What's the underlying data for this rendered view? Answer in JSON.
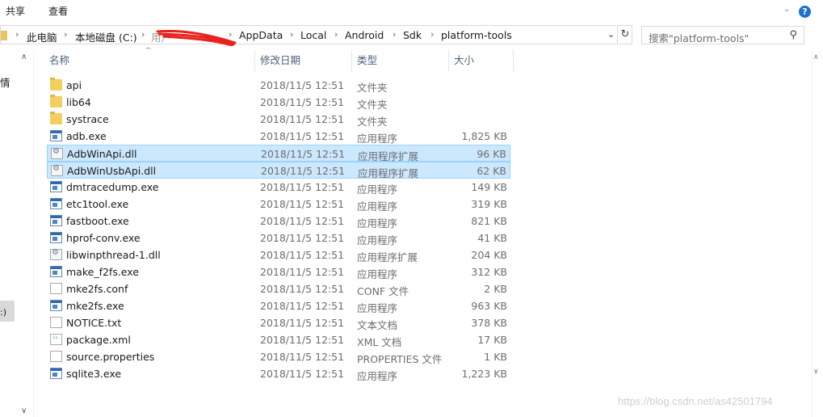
{
  "ribbon": {
    "tabs": [
      "共享",
      "查看"
    ],
    "expand": "⌄",
    "help": "?"
  },
  "address": {
    "crumbs": [
      "此电脑",
      "本地磁盘 (C:)",
      "用户",
      "AppData",
      "Local",
      "Android",
      "Sdk",
      "platform-tools"
    ],
    "dropdown": "⌄",
    "refresh": "↻"
  },
  "search": {
    "placeholder": "搜索\"platform-tools\""
  },
  "nav": {
    "text1": "情",
    "text2": ":)"
  },
  "columns": {
    "name": "名称",
    "date": "修改日期",
    "type": "类型",
    "size": "大小"
  },
  "files": [
    {
      "name": "api",
      "date": "2018/11/5 12:51",
      "type": "文件夹",
      "size": "",
      "icon": "folder-icon",
      "selected": false
    },
    {
      "name": "lib64",
      "date": "2018/11/5 12:51",
      "type": "文件夹",
      "size": "",
      "icon": "folder-icon",
      "selected": false
    },
    {
      "name": "systrace",
      "date": "2018/11/5 12:51",
      "type": "文件夹",
      "size": "",
      "icon": "folder-icon",
      "selected": false
    },
    {
      "name": "adb.exe",
      "date": "2018/11/5 12:51",
      "type": "应用程序",
      "size": "1,825 KB",
      "icon": "exe-icon",
      "selected": false
    },
    {
      "name": "AdbWinApi.dll",
      "date": "2018/11/5 12:51",
      "type": "应用程序扩展",
      "size": "96 KB",
      "icon": "dll-icon",
      "selected": true
    },
    {
      "name": "AdbWinUsbApi.dll",
      "date": "2018/11/5 12:51",
      "type": "应用程序扩展",
      "size": "62 KB",
      "icon": "dll-icon",
      "selected": true
    },
    {
      "name": "dmtracedump.exe",
      "date": "2018/11/5 12:51",
      "type": "应用程序",
      "size": "149 KB",
      "icon": "exe-icon",
      "selected": false
    },
    {
      "name": "etc1tool.exe",
      "date": "2018/11/5 12:51",
      "type": "应用程序",
      "size": "319 KB",
      "icon": "exe-icon",
      "selected": false
    },
    {
      "name": "fastboot.exe",
      "date": "2018/11/5 12:51",
      "type": "应用程序",
      "size": "821 KB",
      "icon": "exe-icon",
      "selected": false
    },
    {
      "name": "hprof-conv.exe",
      "date": "2018/11/5 12:51",
      "type": "应用程序",
      "size": "41 KB",
      "icon": "exe-icon",
      "selected": false
    },
    {
      "name": "libwinpthread-1.dll",
      "date": "2018/11/5 12:51",
      "type": "应用程序扩展",
      "size": "204 KB",
      "icon": "dll-icon",
      "selected": false
    },
    {
      "name": "make_f2fs.exe",
      "date": "2018/11/5 12:51",
      "type": "应用程序",
      "size": "312 KB",
      "icon": "exe-icon",
      "selected": false
    },
    {
      "name": "mke2fs.conf",
      "date": "2018/11/5 12:51",
      "type": "CONF 文件",
      "size": "2 KB",
      "icon": "doc-icon",
      "selected": false
    },
    {
      "name": "mke2fs.exe",
      "date": "2018/11/5 12:51",
      "type": "应用程序",
      "size": "963 KB",
      "icon": "exe-icon",
      "selected": false
    },
    {
      "name": "NOTICE.txt",
      "date": "2018/11/5 12:51",
      "type": "文本文档",
      "size": "378 KB",
      "icon": "txt-icon",
      "selected": false
    },
    {
      "name": "package.xml",
      "date": "2018/11/5 12:51",
      "type": "XML 文档",
      "size": "17 KB",
      "icon": "xml-icon",
      "selected": false
    },
    {
      "name": "source.properties",
      "date": "2018/11/5 12:51",
      "type": "PROPERTIES 文件",
      "size": "1 KB",
      "icon": "doc-icon",
      "selected": false
    },
    {
      "name": "sqlite3.exe",
      "date": "2018/11/5 12:51",
      "type": "应用程序",
      "size": "1,223 KB",
      "icon": "exe-icon",
      "selected": false
    }
  ],
  "watermark": "https://blog.csdn.net/as42501794",
  "colors": {
    "selection": "#cce8ff",
    "selection_border": "#99d1ff",
    "folder": "#f3cf5f",
    "accent": "#1e6fd0",
    "redaction": "#e8231f"
  }
}
